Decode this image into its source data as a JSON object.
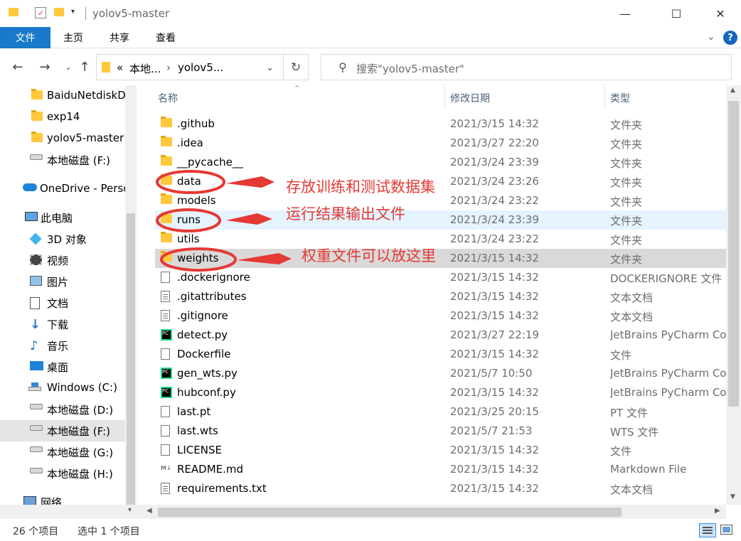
{
  "window": {
    "title": "yolov5-master",
    "minimize": "—",
    "maximize": "☐",
    "close": "✕"
  },
  "ribbon": {
    "tabs": [
      {
        "label": "文件"
      },
      {
        "label": "主页"
      },
      {
        "label": "共享"
      },
      {
        "label": "查看"
      }
    ],
    "help": "?"
  },
  "address": {
    "prefix": "«",
    "crumb1": "本地...",
    "crumb2": "yolov5...",
    "search_placeholder": "搜索\"yolov5-master\""
  },
  "sidebar": {
    "items": [
      {
        "label": "BaiduNetdiskDo",
        "icon": "folder-icon"
      },
      {
        "label": "exp14",
        "icon": "folder-icon"
      },
      {
        "label": "yolov5-master",
        "icon": "folder-icon"
      },
      {
        "label": "本地磁盘 (F:)",
        "icon": "drive-icon"
      },
      {
        "label": "OneDrive - Perso",
        "icon": "cloud-icon"
      },
      {
        "label": "此电脑",
        "icon": "computer-icon"
      },
      {
        "label": "3D 对象",
        "icon": "3d-objects-icon"
      },
      {
        "label": "视频",
        "icon": "video-icon"
      },
      {
        "label": "图片",
        "icon": "pictures-icon"
      },
      {
        "label": "文档",
        "icon": "documents-icon"
      },
      {
        "label": "下载",
        "icon": "download-icon"
      },
      {
        "label": "音乐",
        "icon": "music-icon"
      },
      {
        "label": "桌面",
        "icon": "desktop-icon"
      },
      {
        "label": "Windows (C:)",
        "icon": "windows-drive-icon"
      },
      {
        "label": "本地磁盘 (D:)",
        "icon": "drive-icon"
      },
      {
        "label": "本地磁盘 (F:)",
        "icon": "drive-icon"
      },
      {
        "label": "本地磁盘 (G:)",
        "icon": "drive-icon"
      },
      {
        "label": "本地磁盘 (H:)",
        "icon": "drive-icon"
      },
      {
        "label": "网络",
        "icon": "network-icon"
      }
    ]
  },
  "columns": {
    "name": "名称",
    "date": "修改日期",
    "type": "类型"
  },
  "files": [
    {
      "name": ".github",
      "date": "2021/3/15 14:32",
      "type": "文件夹",
      "icon": "folder-icon"
    },
    {
      "name": ".idea",
      "date": "2021/3/27 22:20",
      "type": "文件夹",
      "icon": "folder-icon"
    },
    {
      "name": "__pycache__",
      "date": "2021/3/24 23:39",
      "type": "文件夹",
      "icon": "folder-icon"
    },
    {
      "name": "data",
      "date": "2021/3/24 23:26",
      "type": "文件夹",
      "icon": "folder-icon"
    },
    {
      "name": "models",
      "date": "2021/3/24 23:22",
      "type": "文件夹",
      "icon": "folder-icon"
    },
    {
      "name": "runs",
      "date": "2021/3/24 23:39",
      "type": "文件夹",
      "icon": "folder-icon"
    },
    {
      "name": "utils",
      "date": "2021/3/24 23:22",
      "type": "文件夹",
      "icon": "folder-icon"
    },
    {
      "name": "weights",
      "date": "2021/3/15 14:32",
      "type": "文件夹",
      "icon": "folder-icon"
    },
    {
      "name": ".dockerignore",
      "date": "2021/3/15 14:32",
      "type": "DOCKERIGNORE 文件",
      "icon": "file-icon"
    },
    {
      "name": ".gitattributes",
      "date": "2021/3/15 14:32",
      "type": "文本文档",
      "icon": "text-file-icon"
    },
    {
      "name": ".gitignore",
      "date": "2021/3/15 14:32",
      "type": "文本文档",
      "icon": "text-file-icon"
    },
    {
      "name": "detect.py",
      "date": "2021/3/27 22:19",
      "type": "JetBrains PyCharm Co...",
      "icon": "pycharm-icon"
    },
    {
      "name": "Dockerfile",
      "date": "2021/3/15 14:32",
      "type": "文件",
      "icon": "file-icon"
    },
    {
      "name": "gen_wts.py",
      "date": "2021/5/7 10:50",
      "type": "JetBrains PyCharm Co...",
      "icon": "pycharm-icon"
    },
    {
      "name": "hubconf.py",
      "date": "2021/3/15 14:32",
      "type": "JetBrains PyCharm Co...",
      "icon": "pycharm-icon"
    },
    {
      "name": "last.pt",
      "date": "2021/3/25 20:15",
      "type": "PT 文件",
      "icon": "file-icon"
    },
    {
      "name": "last.wts",
      "date": "2021/5/7 21:53",
      "type": "WTS 文件",
      "icon": "file-icon"
    },
    {
      "name": "LICENSE",
      "date": "2021/3/15 14:32",
      "type": "文件",
      "icon": "file-icon"
    },
    {
      "name": "README.md",
      "date": "2021/3/15 14:32",
      "type": "Markdown File",
      "icon": "markdown-icon"
    },
    {
      "name": "requirements.txt",
      "date": "2021/3/15 14:32",
      "type": "文本文档",
      "icon": "text-file-icon"
    }
  ],
  "status": {
    "count": "26 个项目",
    "selection": "选中 1 个项目"
  },
  "annotations": {
    "data_note": "存放训练和测试数据集",
    "runs_note": "运行结果输出文件",
    "weights_note": "权重文件可以放这里",
    "color": "#e53935"
  }
}
